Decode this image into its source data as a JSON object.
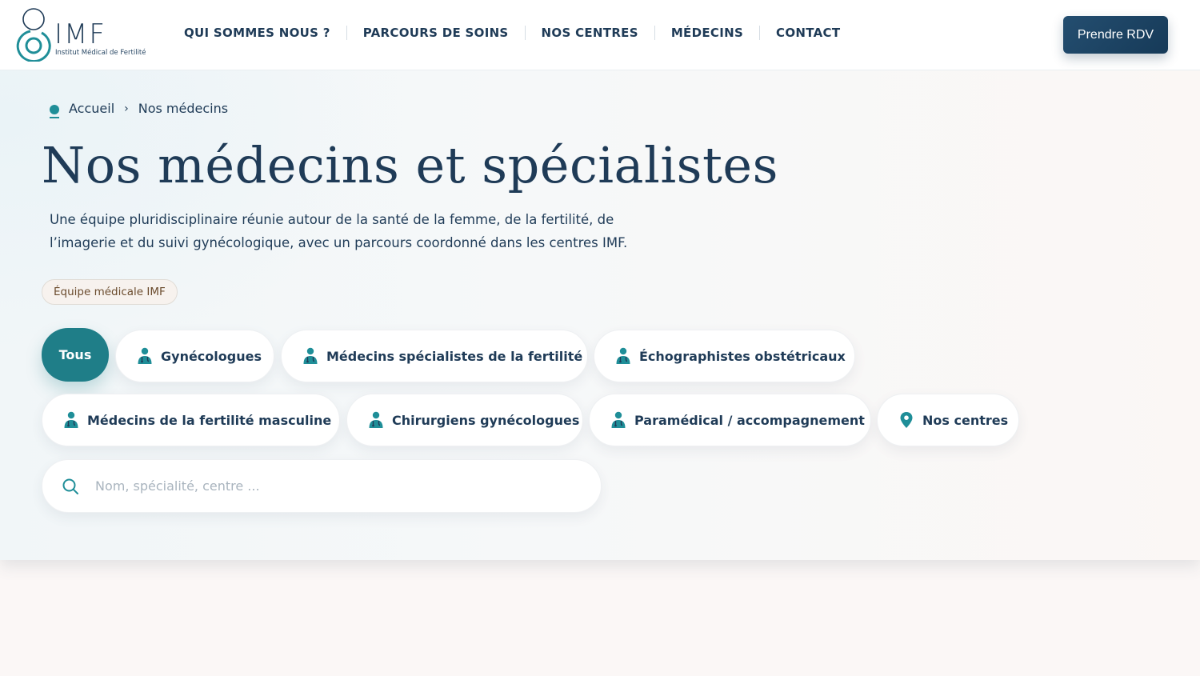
{
  "header": {
    "logo": {
      "text": "IMF",
      "subtitle": "Institut Médical de Fertilité"
    },
    "nav": [
      {
        "label": "QUI SOMMES NOUS ?"
      },
      {
        "label": "PARCOURS DE SOINS"
      },
      {
        "label": "NOS CENTRES"
      },
      {
        "label": "MÉDECINS"
      },
      {
        "label": "CONTACT"
      }
    ],
    "cta_label": "Prendre RDV"
  },
  "breadcrumb": {
    "home_label": "Accueil",
    "separator": "›",
    "current_label": "Nos médecins"
  },
  "hero": {
    "title": "Nos médecins et spécialistes",
    "intro_line1": "Une équipe pluridisciplinaire réunie autour de la santé de la femme, de la fertilité, de",
    "intro_line2": "l’imagerie et du suivi gynécologique, avec un parcours coordonné dans les centres IMF.",
    "badge": "Équipe médicale IMF"
  },
  "filters": [
    {
      "label": "Tous",
      "icon": "none",
      "active": true
    },
    {
      "label": "Gynécologues",
      "icon": "doctor-icon",
      "active": false
    },
    {
      "label": "Médecins spécialistes de la fertilité",
      "icon": "doctor-icon",
      "active": false
    },
    {
      "label": "Échographistes obstétricaux",
      "icon": "doctor-icon",
      "active": false
    },
    {
      "label": "Médecins de la fertilité masculine",
      "icon": "doctor-icon",
      "active": false
    },
    {
      "label": "Chirurgiens gynécologues",
      "icon": "doctor-icon",
      "active": false
    },
    {
      "label": "Paramédical / accompagnement",
      "icon": "doctor-icon",
      "active": false
    },
    {
      "label": "Nos centres",
      "icon": "location-pin-icon",
      "active": false
    }
  ],
  "search": {
    "placeholder": "Nom, spécialité, centre ...",
    "value": ""
  },
  "colors": {
    "primary": "#1f3b57",
    "accent_teal": "#1f7e88",
    "cta": "#1d4566",
    "badge_text": "#6b4c2e"
  }
}
